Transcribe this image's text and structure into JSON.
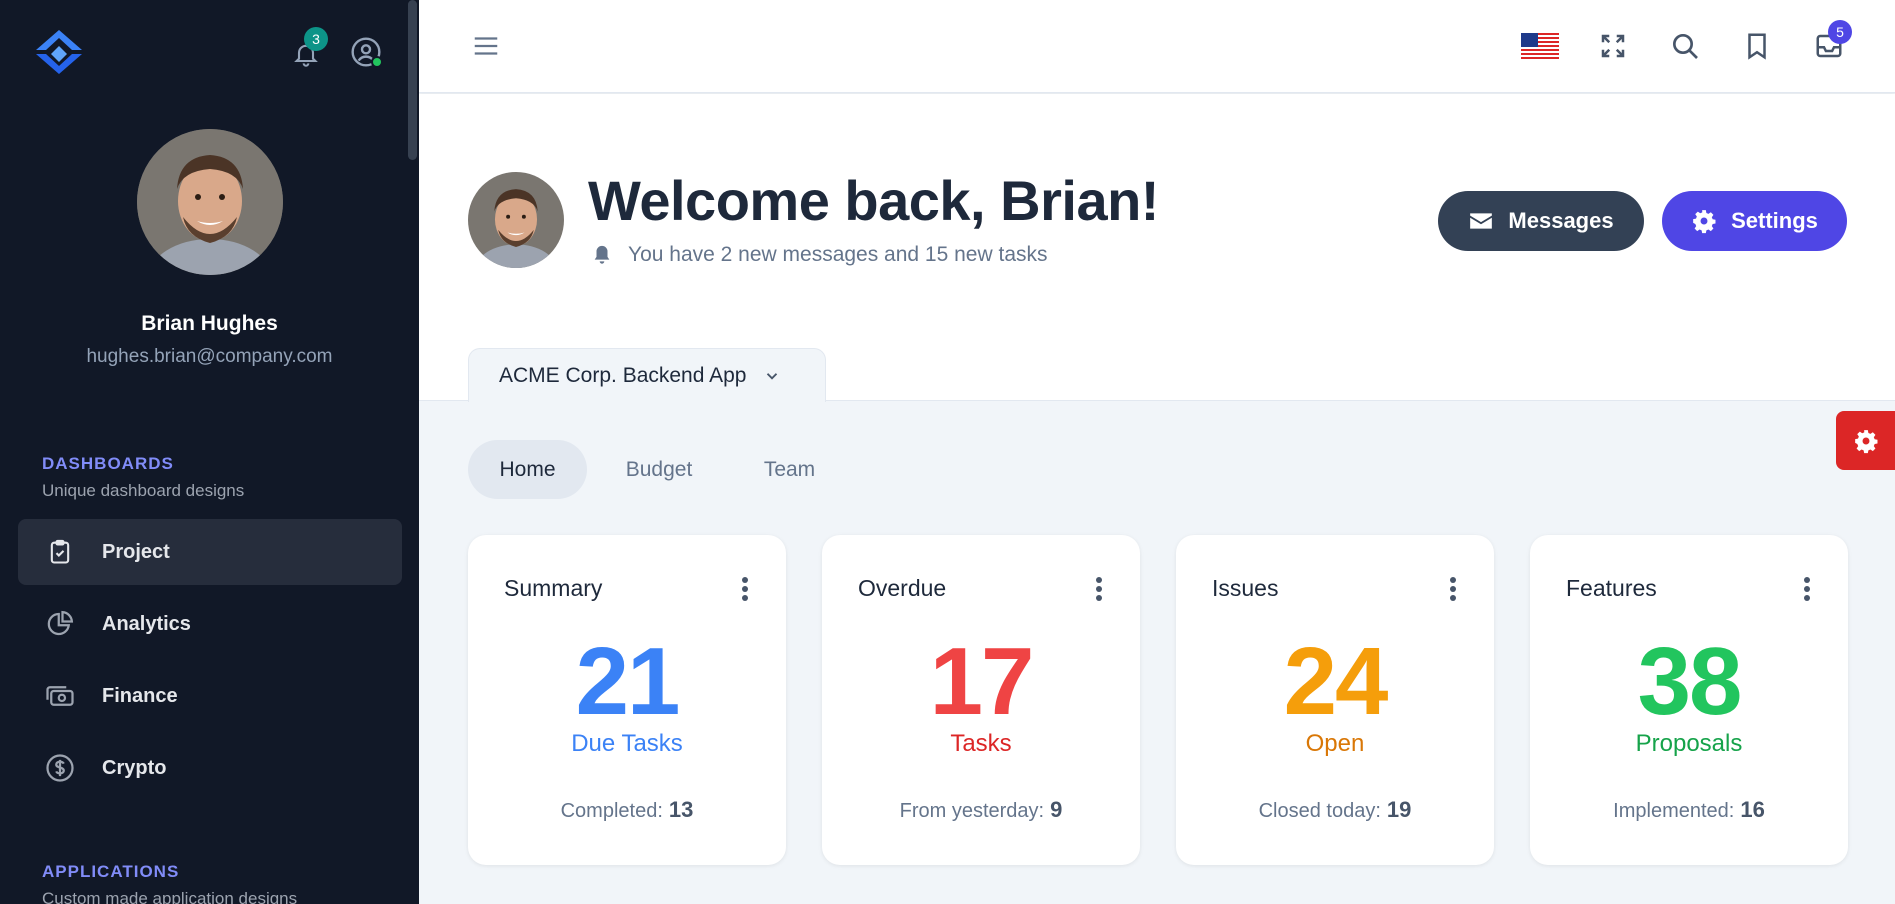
{
  "sidebar": {
    "notifications_count": "3",
    "user": {
      "name": "Brian Hughes",
      "email": "hughes.brian@company.com"
    },
    "sections": [
      {
        "title": "DASHBOARDS",
        "subtitle": "Unique dashboard designs"
      },
      {
        "title": "APPLICATIONS",
        "subtitle": "Custom made application designs"
      }
    ],
    "items": [
      {
        "label": "Project",
        "icon": "clipboard-check-icon",
        "active": true
      },
      {
        "label": "Analytics",
        "icon": "chart-pie-icon"
      },
      {
        "label": "Finance",
        "icon": "cash-icon"
      },
      {
        "label": "Crypto",
        "icon": "currency-dollar-icon"
      }
    ]
  },
  "topbar": {
    "icons": [
      "menu-icon",
      "us-flag-icon",
      "fullscreen-icon",
      "search-icon",
      "bookmark-icon",
      "inbox-icon"
    ],
    "inbox_count": "5"
  },
  "header": {
    "welcome": "Welcome back, Brian!",
    "subline": "You have 2 new messages and 15 new tasks",
    "messages_label": "Messages",
    "settings_label": "Settings",
    "project": "ACME Corp. Backend App"
  },
  "tabs": [
    "Home",
    "Budget",
    "Team"
  ],
  "cards": [
    {
      "title": "Summary",
      "number": "21",
      "label": "Due Tasks",
      "foot_label": "Completed:",
      "foot_value": "13",
      "color": "#3b82f6"
    },
    {
      "title": "Overdue",
      "number": "17",
      "label": "Tasks",
      "foot_label": "From yesterday:",
      "foot_value": "9",
      "color": "#ef4444"
    },
    {
      "title": "Issues",
      "number": "24",
      "label": "Open",
      "foot_label": "Closed today:",
      "foot_value": "19",
      "color": "#f59e0b"
    },
    {
      "title": "Features",
      "number": "38",
      "label": "Proposals",
      "foot_label": "Implemented:",
      "foot_value": "16",
      "color": "#22c55e"
    }
  ],
  "colors": {
    "sidebar_bg": "#111827",
    "accent": "#4f46e5",
    "dark_button": "#334155",
    "gear_tab": "#dc2626"
  }
}
